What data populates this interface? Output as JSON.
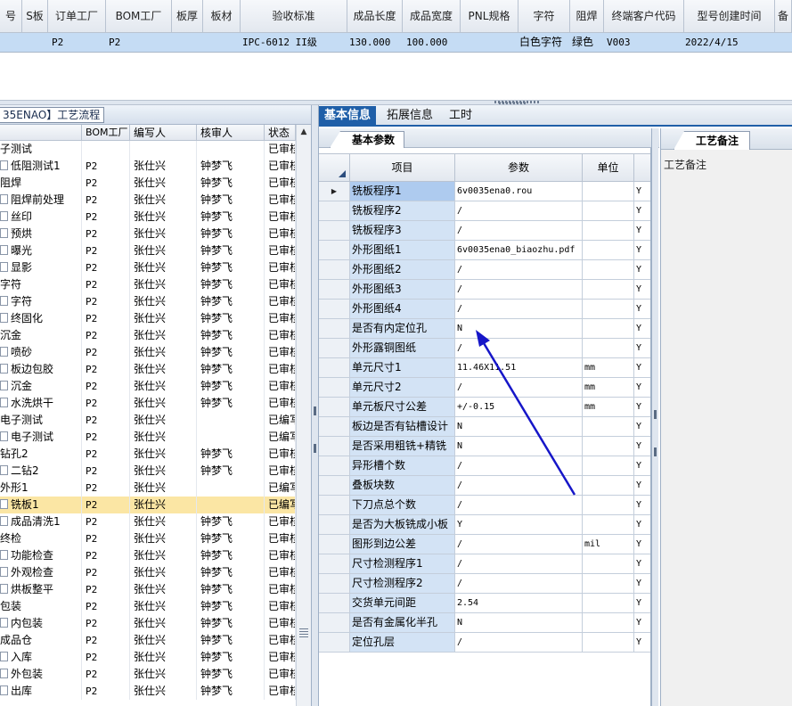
{
  "top_grid": {
    "columns": [
      "号",
      "S板",
      "订单工厂",
      "BOM工厂",
      "板厚",
      "板材",
      "验收标准",
      "成品长度",
      "成品宽度",
      "PNL规格",
      "字符",
      "阻焊",
      "终端客户代码",
      "型号创建时间",
      "备"
    ],
    "row": [
      "",
      "",
      "P2",
      "P2",
      "",
      "",
      "IPC-6012 II级",
      "130.000",
      "100.000",
      "",
      "白色字符",
      "绿色",
      "V003",
      "2022/4/15",
      ""
    ]
  },
  "left_panel": {
    "title": "35ENAO】工艺流程",
    "columns": [
      "",
      "BOM工厂",
      "编写人",
      "核审人",
      "状态"
    ],
    "scroll_up_icon": "▲",
    "rows": [
      {
        "name": "子测试",
        "indent": false,
        "file": false,
        "bom": "",
        "writer": "",
        "reviewer": "",
        "status": "已审核"
      },
      {
        "name": "低阻测试1",
        "indent": true,
        "file": true,
        "bom": "P2",
        "writer": "张仕兴",
        "reviewer": "钟梦飞",
        "status": "已审核"
      },
      {
        "name": "阻焊",
        "indent": false,
        "file": false,
        "bom": "P2",
        "writer": "张仕兴",
        "reviewer": "钟梦飞",
        "status": "已审核"
      },
      {
        "name": "阻焊前处理",
        "indent": true,
        "file": true,
        "bom": "P2",
        "writer": "张仕兴",
        "reviewer": "钟梦飞",
        "status": "已审核"
      },
      {
        "name": "丝印",
        "indent": true,
        "file": true,
        "bom": "P2",
        "writer": "张仕兴",
        "reviewer": "钟梦飞",
        "status": "已审核"
      },
      {
        "name": "预烘",
        "indent": true,
        "file": true,
        "bom": "P2",
        "writer": "张仕兴",
        "reviewer": "钟梦飞",
        "status": "已审核"
      },
      {
        "name": "曝光",
        "indent": true,
        "file": true,
        "bom": "P2",
        "writer": "张仕兴",
        "reviewer": "钟梦飞",
        "status": "已审核"
      },
      {
        "name": "显影",
        "indent": true,
        "file": true,
        "bom": "P2",
        "writer": "张仕兴",
        "reviewer": "钟梦飞",
        "status": "已审核"
      },
      {
        "name": "字符",
        "indent": false,
        "file": false,
        "bom": "P2",
        "writer": "张仕兴",
        "reviewer": "钟梦飞",
        "status": "已审核"
      },
      {
        "name": "字符",
        "indent": true,
        "file": true,
        "bom": "P2",
        "writer": "张仕兴",
        "reviewer": "钟梦飞",
        "status": "已审核"
      },
      {
        "name": "终固化",
        "indent": true,
        "file": true,
        "bom": "P2",
        "writer": "张仕兴",
        "reviewer": "钟梦飞",
        "status": "已审核"
      },
      {
        "name": "沉金",
        "indent": false,
        "file": false,
        "bom": "P2",
        "writer": "张仕兴",
        "reviewer": "钟梦飞",
        "status": "已审核"
      },
      {
        "name": "喷砂",
        "indent": true,
        "file": true,
        "bom": "P2",
        "writer": "张仕兴",
        "reviewer": "钟梦飞",
        "status": "已审核"
      },
      {
        "name": "板边包胶",
        "indent": true,
        "file": true,
        "bom": "P2",
        "writer": "张仕兴",
        "reviewer": "钟梦飞",
        "status": "已审核"
      },
      {
        "name": "沉金",
        "indent": true,
        "file": true,
        "bom": "P2",
        "writer": "张仕兴",
        "reviewer": "钟梦飞",
        "status": "已审核"
      },
      {
        "name": "水洗烘干",
        "indent": true,
        "file": true,
        "bom": "P2",
        "writer": "张仕兴",
        "reviewer": "钟梦飞",
        "status": "已审核"
      },
      {
        "name": "电子测试",
        "indent": false,
        "file": false,
        "bom": "P2",
        "writer": "张仕兴",
        "reviewer": "",
        "status": "已编写"
      },
      {
        "name": "电子测试",
        "indent": true,
        "file": true,
        "bom": "P2",
        "writer": "张仕兴",
        "reviewer": "",
        "status": "已编写"
      },
      {
        "name": "钻孔2",
        "indent": false,
        "file": false,
        "bom": "P2",
        "writer": "张仕兴",
        "reviewer": "钟梦飞",
        "status": "已审核"
      },
      {
        "name": "二钻2",
        "indent": true,
        "file": true,
        "bom": "P2",
        "writer": "张仕兴",
        "reviewer": "钟梦飞",
        "status": "已审核"
      },
      {
        "name": "外形1",
        "indent": false,
        "file": false,
        "bom": "P2",
        "writer": "张仕兴",
        "reviewer": "",
        "status": "已编写"
      },
      {
        "name": "铣板1",
        "indent": true,
        "file": true,
        "bom": "P2",
        "writer": "张仕兴",
        "reviewer": "",
        "status": "已编写",
        "selected": true
      },
      {
        "name": "成品清洗1",
        "indent": true,
        "file": true,
        "bom": "P2",
        "writer": "张仕兴",
        "reviewer": "钟梦飞",
        "status": "已审核"
      },
      {
        "name": "终检",
        "indent": false,
        "file": false,
        "bom": "P2",
        "writer": "张仕兴",
        "reviewer": "钟梦飞",
        "status": "已审核"
      },
      {
        "name": "功能检查",
        "indent": true,
        "file": true,
        "bom": "P2",
        "writer": "张仕兴",
        "reviewer": "钟梦飞",
        "status": "已审核"
      },
      {
        "name": "外观检查",
        "indent": true,
        "file": true,
        "bom": "P2",
        "writer": "张仕兴",
        "reviewer": "钟梦飞",
        "status": "已审核"
      },
      {
        "name": "烘板整平",
        "indent": true,
        "file": true,
        "bom": "P2",
        "writer": "张仕兴",
        "reviewer": "钟梦飞",
        "status": "已审核"
      },
      {
        "name": "包装",
        "indent": false,
        "file": false,
        "bom": "P2",
        "writer": "张仕兴",
        "reviewer": "钟梦飞",
        "status": "已审核"
      },
      {
        "name": "内包装",
        "indent": true,
        "file": true,
        "bom": "P2",
        "writer": "张仕兴",
        "reviewer": "钟梦飞",
        "status": "已审核"
      },
      {
        "name": "成品仓",
        "indent": false,
        "file": false,
        "bom": "P2",
        "writer": "张仕兴",
        "reviewer": "钟梦飞",
        "status": "已审核"
      },
      {
        "name": "入库",
        "indent": true,
        "file": true,
        "bom": "P2",
        "writer": "张仕兴",
        "reviewer": "钟梦飞",
        "status": "已审核"
      },
      {
        "name": "外包装",
        "indent": true,
        "file": true,
        "bom": "P2",
        "writer": "张仕兴",
        "reviewer": "钟梦飞",
        "status": "已审核"
      },
      {
        "name": "出库",
        "indent": true,
        "file": true,
        "bom": "P2",
        "writer": "张仕兴",
        "reviewer": "钟梦飞",
        "status": "已审核"
      }
    ]
  },
  "right_panel": {
    "tabs": [
      "基本信息",
      "拓展信息",
      "工时"
    ],
    "active_tab": 0,
    "sub_tab": "基本参数",
    "param_columns": [
      "项目",
      "参数",
      "单位"
    ],
    "current_row_icon": "▶",
    "params": [
      {
        "item": "铣板程序1",
        "param": "6v0035ena0.rou",
        "unit": "",
        "flag": "Y"
      },
      {
        "item": "铣板程序2",
        "param": "/",
        "unit": "",
        "flag": "Y"
      },
      {
        "item": "铣板程序3",
        "param": "/",
        "unit": "",
        "flag": "Y"
      },
      {
        "item": "外形图纸1",
        "param": "6v0035ena0_biaozhu.pdf",
        "unit": "",
        "flag": "Y"
      },
      {
        "item": "外形图纸2",
        "param": "/",
        "unit": "",
        "flag": "Y"
      },
      {
        "item": "外形图纸3",
        "param": "/",
        "unit": "",
        "flag": "Y"
      },
      {
        "item": "外形图纸4",
        "param": "/",
        "unit": "",
        "flag": "Y"
      },
      {
        "item": "是否有内定位孔",
        "param": "N",
        "unit": "",
        "flag": "Y"
      },
      {
        "item": "外形露铜图纸",
        "param": "/",
        "unit": "",
        "flag": "Y"
      },
      {
        "item": "单元尺寸1",
        "param": "11.46X11.51",
        "unit": "mm",
        "flag": "Y"
      },
      {
        "item": "单元尺寸2",
        "param": "/",
        "unit": "mm",
        "flag": "Y"
      },
      {
        "item": "单元板尺寸公差",
        "param": "+/-0.15",
        "unit": "mm",
        "flag": "Y"
      },
      {
        "item": "板边是否有钻槽设计",
        "param": "N",
        "unit": "",
        "flag": "Y"
      },
      {
        "item": "是否采用粗铣+精铣",
        "param": "N",
        "unit": "",
        "flag": "Y"
      },
      {
        "item": "异形槽个数",
        "param": "/",
        "unit": "",
        "flag": "Y"
      },
      {
        "item": "叠板块数",
        "param": "/",
        "unit": "",
        "flag": "Y"
      },
      {
        "item": "下刀点总个数",
        "param": "/",
        "unit": "",
        "flag": "Y"
      },
      {
        "item": "是否为大板铣成小板",
        "param": "Y",
        "unit": "",
        "flag": "Y"
      },
      {
        "item": "图形到边公差",
        "param": "/",
        "unit": "mil",
        "flag": "Y"
      },
      {
        "item": "尺寸检测程序1",
        "param": "/",
        "unit": "",
        "flag": "Y"
      },
      {
        "item": "尺寸检测程序2",
        "param": "/",
        "unit": "",
        "flag": "Y"
      },
      {
        "item": "交货单元间距",
        "param": "2.54",
        "unit": "",
        "flag": "Y"
      },
      {
        "item": "是否有金属化半孔",
        "param": "N",
        "unit": "",
        "flag": "Y"
      },
      {
        "item": "定位孔层",
        "param": "/",
        "unit": "",
        "flag": "Y"
      }
    ],
    "remark_tab": "工艺备注",
    "remark_label": "工艺备注"
  },
  "colors": {
    "active_tab": "#1f5fa8",
    "selected_row": "#fbe6a4",
    "top_row_bg": "#c5dcf4",
    "item_cell_bg": "#d3e3f5",
    "annotation_arrow": "#1616c8"
  }
}
